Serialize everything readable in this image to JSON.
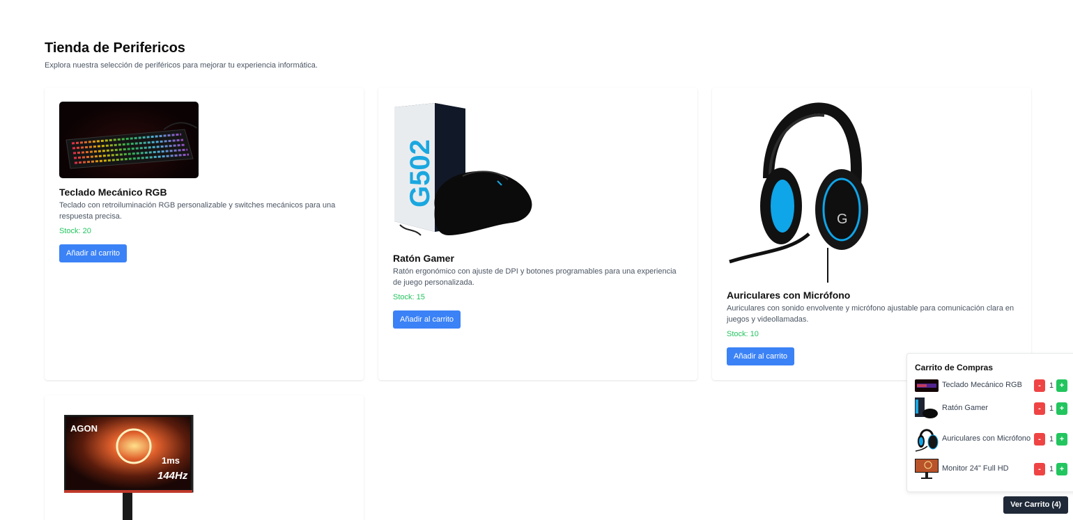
{
  "header": {
    "title": "Tienda de Perifericos",
    "subtitle": "Explora nuestra selección de periféricos para mejorar tu experiencia informática."
  },
  "products": [
    {
      "name": "Teclado Mecánico RGB",
      "description": "Teclado con retroiluminación RGB personalizable y switches mecánicos para una respuesta precisa.",
      "stock": "Stock: 20",
      "button": "Añadir al carrito",
      "image": "keyboard-image"
    },
    {
      "name": "Ratón Gamer",
      "description": "Ratón ergonómico con ajuste de DPI y botones programables para una experiencia de juego personalizada.",
      "stock": "Stock: 15",
      "button": "Añadir al carrito",
      "image": "mouse-image",
      "box_text": "G502"
    },
    {
      "name": "Auriculares con Micrófono",
      "description": "Auriculares con sonido envolvente y micrófono ajustable para comunicación clara en juegos y videollamadas.",
      "stock": "Stock: 10",
      "button": "Añadir al carrito",
      "image": "headset-image"
    },
    {
      "name": "Monitor 24\" Full HD",
      "image": "monitor-image",
      "screen_brand": "AGON",
      "screen_refresh": "144Hz",
      "screen_response": "1ms"
    }
  ],
  "cart": {
    "title": "Carrito de Compras",
    "items": [
      {
        "name": "Teclado Mecánico RGB",
        "qty": "1",
        "minus": "-",
        "plus": "+"
      },
      {
        "name": "Ratón Gamer",
        "qty": "1",
        "minus": "-",
        "plus": "+"
      },
      {
        "name": "Auriculares con Micrófono",
        "qty": "1",
        "minus": "-",
        "plus": "+"
      },
      {
        "name": "Monitor 24\" Full HD",
        "qty": "1",
        "minus": "-",
        "plus": "+"
      }
    ],
    "view_button": "Ver Carrito (4)"
  },
  "colors": {
    "primary": "#3b82f6",
    "stock": "#22c55e",
    "minus": "#ef4444",
    "plus": "#22c55e",
    "dark": "#1f2937"
  }
}
